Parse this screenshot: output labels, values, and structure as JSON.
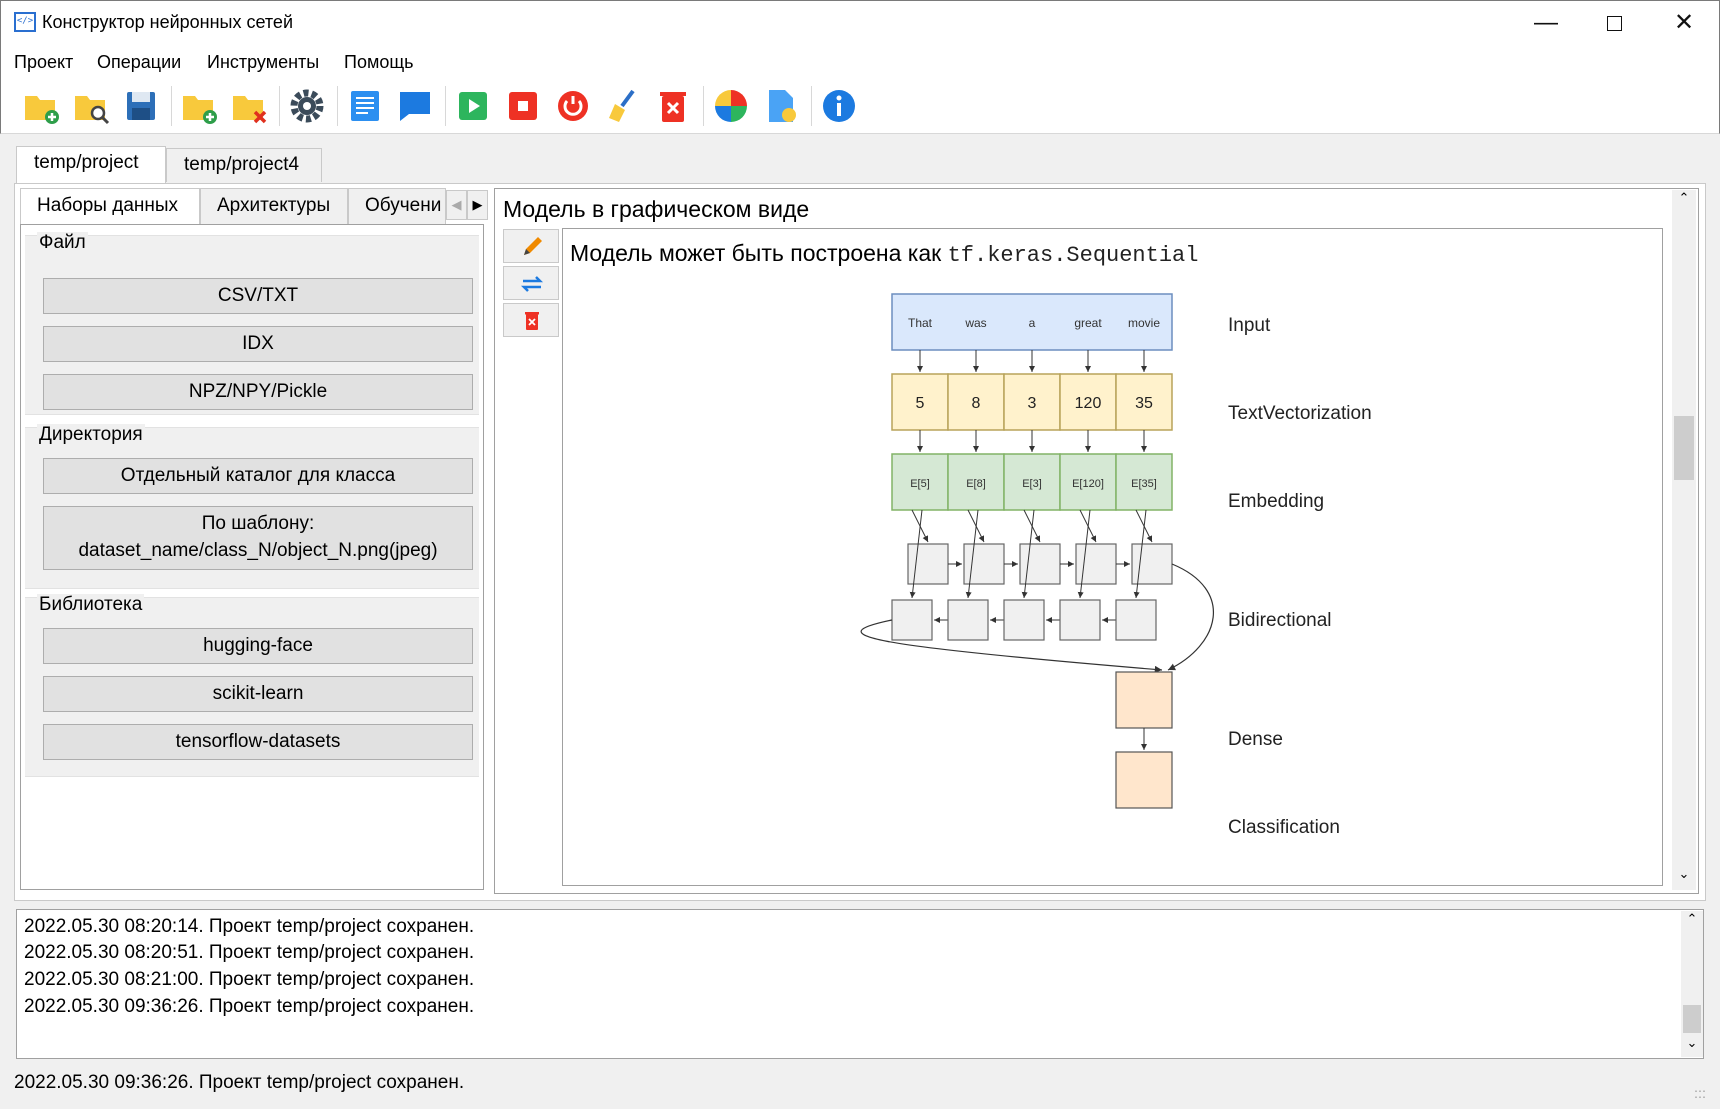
{
  "window": {
    "title": "Конструктор нейронных сетей",
    "app_icon": "</>"
  },
  "menu": [
    "Проект",
    "Операции",
    "Инструменты",
    "Помощь"
  ],
  "toolbar_icons": [
    "new-project-icon",
    "open-project-icon",
    "save-icon",
    "add-folder-icon",
    "delete-folder-icon",
    "settings-icon",
    "document-icon",
    "comment-icon",
    "run-icon",
    "stop-icon",
    "restart-icon",
    "clear-icon",
    "delete-icon",
    "color-wheel-icon",
    "file-settings-icon",
    "info-icon"
  ],
  "project_tabs": [
    "temp/project",
    "temp/project4"
  ],
  "sub_tabs": [
    "Наборы данных",
    "Архитектуры",
    "Обучени"
  ],
  "datasets": {
    "file": {
      "title": "Файл",
      "buttons": [
        "CSV/TXT",
        "IDX",
        "NPZ/NPY/Pickle"
      ]
    },
    "directory": {
      "title": "Директория",
      "buttons": [
        "Отдельный каталог для класса"
      ],
      "template_line1": "По шаблону:",
      "template_line2": "dataset_name/class_N/object_N.png(jpeg)"
    },
    "library": {
      "title": "Библиотека",
      "buttons": [
        "hugging-face",
        "scikit-learn",
        "tensorflow-datasets"
      ]
    }
  },
  "model": {
    "title": "Модель в графическом виде",
    "caption_prefix": "Модель может быть построена как ",
    "caption_code": "tf.keras.Sequential",
    "diagram": {
      "words": [
        "That",
        "was",
        "a",
        "great",
        "movie"
      ],
      "token_ids": [
        "5",
        "8",
        "3",
        "120",
        "35"
      ],
      "embeddings": [
        "E[5]",
        "E[8]",
        "E[3]",
        "E[120]",
        "E[35]"
      ],
      "layers": [
        "Input",
        "TextVectorization",
        "Embedding",
        "Bidirectional",
        "Dense",
        "Classification"
      ],
      "colors": {
        "input": "#dae8fc",
        "vector": "#fff2cc",
        "embed": "#d5e8d4",
        "rnn": "#f0f0f0",
        "dense": "#ffe6cc"
      }
    }
  },
  "log": [
    "2022.05.30 08:20:14. Проект temp/project сохранен.",
    "2022.05.30 08:20:51. Проект temp/project сохранен.",
    "2022.05.30 08:21:00. Проект temp/project сохранен.",
    "2022.05.30 09:36:26. Проект temp/project сохранен."
  ],
  "status": "2022.05.30 09:36:26. Проект temp/project сохранен."
}
